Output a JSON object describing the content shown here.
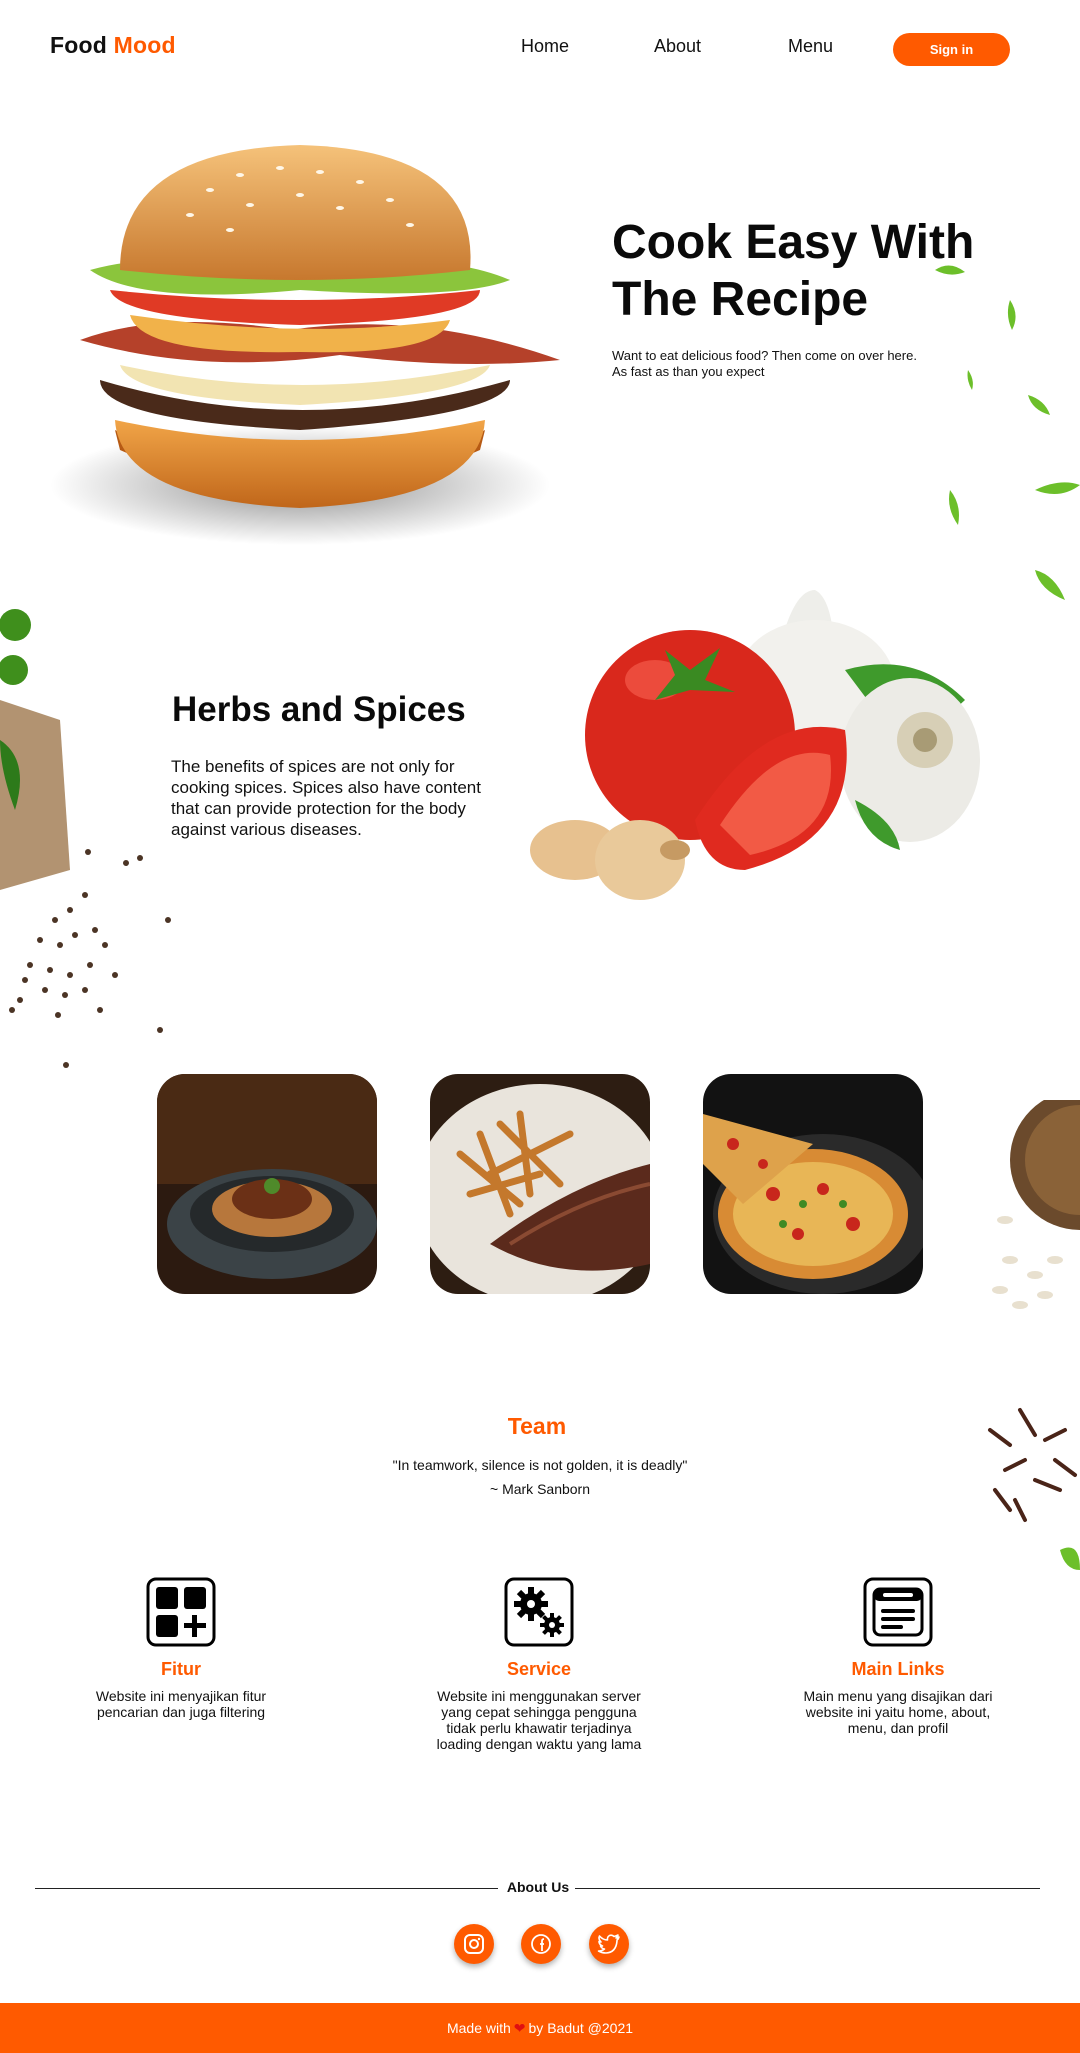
{
  "brand": {
    "first": "Food",
    "second": "Mood",
    "accent_color": "#FF5A00"
  },
  "nav": {
    "home": "Home",
    "about": "About",
    "menu": "Menu",
    "signin": "Sign in"
  },
  "hero": {
    "title": "Cook Easy With The Recipe",
    "subtitle_line1": "Want to eat delicious food? Then come on over here.",
    "subtitle_line2": "As fast as than you expect"
  },
  "herbs": {
    "title": "Herbs and Spices",
    "text": "The benefits of spices are not only for cooking spices. Spices also have content that can provide protection for the body against various diseases."
  },
  "gallery": {
    "items": [
      "spaghetti-bowl",
      "steak-and-fries",
      "pizza"
    ]
  },
  "team": {
    "title": "Team",
    "quote": "\"In teamwork, silence is not golden, it is deadly\"",
    "author": "~ Mark Sanborn"
  },
  "features": [
    {
      "icon": "apps-add-icon",
      "title": "Fitur",
      "text": "Website ini menyajikan fitur pencarian dan juga filtering"
    },
    {
      "icon": "gears-icon",
      "title": "Service",
      "text": "Website ini menggunakan server yang cepat sehingga pengguna tidak perlu khawatir terjadinya loading dengan waktu yang lama"
    },
    {
      "icon": "browser-window-icon",
      "title": "Main Links",
      "text": "Main menu yang disajikan dari website ini yaitu home, about, menu, dan profil"
    }
  ],
  "about": {
    "title": "About Us",
    "socials": [
      "instagram-icon",
      "facebook-icon",
      "twitter-icon"
    ]
  },
  "footer": {
    "made_with": "Made with",
    "by": "by Badut @2021",
    "heart": "❤"
  }
}
